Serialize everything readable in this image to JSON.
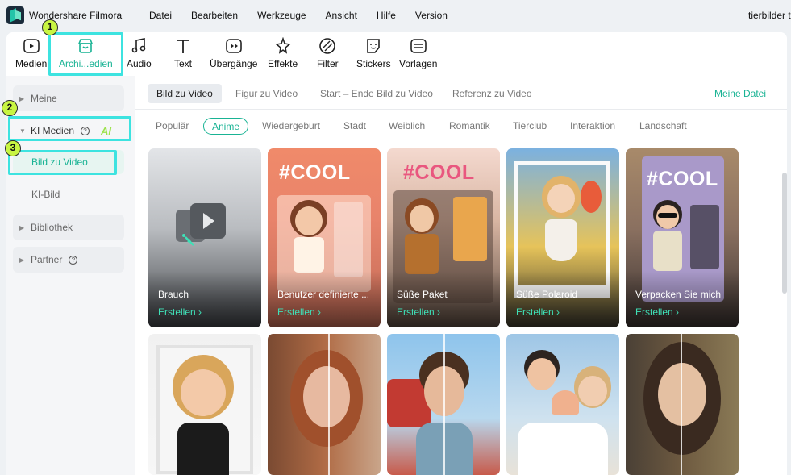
{
  "app": {
    "title": "Wondershare Filmora",
    "project_name": "tierbilder t"
  },
  "menu": {
    "items": [
      "Datei",
      "Bearbeiten",
      "Werkzeuge",
      "Ansicht",
      "Hilfe",
      "Version"
    ]
  },
  "toolbar": {
    "items": [
      {
        "label": "Medien",
        "icon": "media-icon"
      },
      {
        "label": "Archi...edien",
        "icon": "store-icon",
        "active": true
      },
      {
        "label": "Audio",
        "icon": "music-note-icon"
      },
      {
        "label": "Text",
        "icon": "text-icon"
      },
      {
        "label": "Übergänge",
        "icon": "transition-icon"
      },
      {
        "label": "Effekte",
        "icon": "effects-icon"
      },
      {
        "label": "Filter",
        "icon": "filter-icon"
      },
      {
        "label": "Stickers",
        "icon": "sticker-icon"
      },
      {
        "label": "Vorlagen",
        "icon": "template-icon"
      }
    ]
  },
  "annotations": {
    "badge1": "1",
    "badge2": "2",
    "badge3": "3",
    "highlight_color": "#3de3e0",
    "badge_color": "#c8f542"
  },
  "sidebar": {
    "meine": "Meine",
    "ki_medien": "KI Medien",
    "ai_tag": "AI",
    "bild_zu_video": "Bild zu Video",
    "ki_bild": "KI-Bild",
    "bibliothek": "Bibliothek",
    "partner": "Partner",
    "help_glyph": "?"
  },
  "subtabs": {
    "items": [
      "Bild zu Video",
      "Figur zu Video",
      "Start – Ende Bild zu Video",
      "Referenz zu Video"
    ],
    "active": "Bild zu Video",
    "my_files": "Meine Datei"
  },
  "categories": {
    "items": [
      "Populär",
      "Anime",
      "Wiedergeburt",
      "Stadt",
      "Weiblich",
      "Romantik",
      "Tierclub",
      "Interaktion",
      "Landschaft"
    ],
    "active": "Anime"
  },
  "cards": {
    "row1": [
      {
        "caption": "Brauch",
        "action": "Erstellen  ›"
      },
      {
        "caption": "Benutzer definierte ...",
        "action": "Erstellen  ›",
        "overlay": "#COOL"
      },
      {
        "caption": "Süße Paket",
        "action": "Erstellen  ›",
        "overlay": "#COOL"
      },
      {
        "caption": "Süße Polaroid",
        "action": "Erstellen  ›"
      },
      {
        "caption": "Verpacken Sie mich",
        "action": "Erstellen  ›",
        "overlay": "#COOL"
      }
    ]
  },
  "colors": {
    "accent": "#19b394",
    "create_link": "#3fe0b7"
  }
}
